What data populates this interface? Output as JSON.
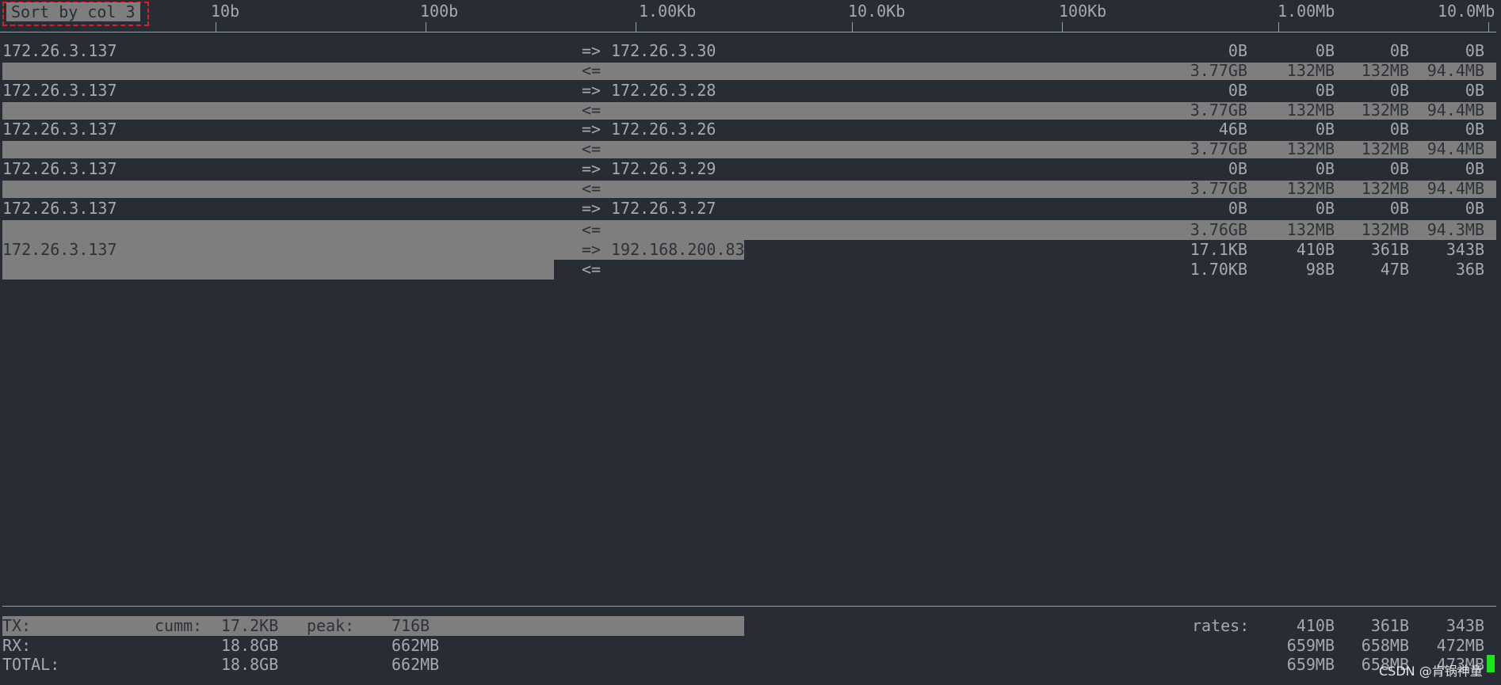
{
  "header": {
    "sort_label": "Sort by col 3",
    "scale_ticks": [
      "10b",
      "100b",
      "1.00Kb",
      "10.0Kb",
      "100Kb",
      "1.00Mb",
      "10.0Mb"
    ]
  },
  "connections": [
    {
      "src": "172.26.3.137",
      "dst": "172.26.3.30",
      "out_arrow": "=>",
      "in_arrow": "<=",
      "tx": [
        "0B",
        "0B",
        "0B",
        "0B"
      ],
      "rx": [
        "3.77GB",
        "132MB",
        "132MB",
        "94.4MB"
      ]
    },
    {
      "src": "172.26.3.137",
      "dst": "172.26.3.28",
      "out_arrow": "=>",
      "in_arrow": "<=",
      "tx": [
        "0B",
        "0B",
        "0B",
        "0B"
      ],
      "rx": [
        "3.77GB",
        "132MB",
        "132MB",
        "94.4MB"
      ]
    },
    {
      "src": "172.26.3.137",
      "dst": "172.26.3.26",
      "out_arrow": "=>",
      "in_arrow": "<=",
      "tx": [
        "46B",
        "0B",
        "0B",
        "0B"
      ],
      "rx": [
        "3.77GB",
        "132MB",
        "132MB",
        "94.4MB"
      ]
    },
    {
      "src": "172.26.3.137",
      "dst": "172.26.3.29",
      "out_arrow": "=>",
      "in_arrow": "<=",
      "tx": [
        "0B",
        "0B",
        "0B",
        "0B"
      ],
      "rx": [
        "3.77GB",
        "132MB",
        "132MB",
        "94.4MB"
      ]
    },
    {
      "src": "172.26.3.137",
      "dst": "172.26.3.27",
      "out_arrow": "=>",
      "in_arrow": "<=",
      "tx": [
        "0B",
        "0B",
        "0B",
        "0B"
      ],
      "rx": [
        "3.76GB",
        "132MB",
        "132MB",
        "94.3MB"
      ]
    },
    {
      "src": "172.26.3.137",
      "dst": "192.168.200.83",
      "out_arrow": "=>",
      "in_arrow": "<=",
      "tx": [
        "17.1KB",
        "410B",
        "361B",
        "343B"
      ],
      "rx": [
        "1.70KB",
        "98B",
        "47B",
        "36B"
      ]
    }
  ],
  "footer": {
    "tx_label": "TX:",
    "rx_label": "RX:",
    "total_label": "TOTAL:",
    "cumm_label": "cumm:",
    "peak_label": "peak:",
    "rates_label": "rates:",
    "tx_cumm": "17.2KB",
    "tx_peak": "716B",
    "rx_cumm": "18.8GB",
    "rx_peak": "662MB",
    "total_cumm": "18.8GB",
    "total_peak": "662MB",
    "tx_rates": [
      "410B",
      "361B",
      "343B"
    ],
    "rx_rates": [
      "659MB",
      "658MB",
      "472MB"
    ],
    "total_rates": [
      "659MB",
      "658MB",
      "473MB"
    ]
  },
  "watermark": "CSDN @肯锅神童"
}
